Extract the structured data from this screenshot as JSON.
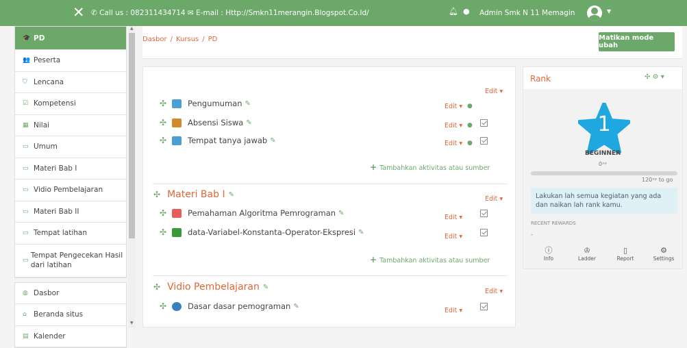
{
  "header": {
    "close_glyph": "✕",
    "contact_text": "Call us : 082311434714 ✉ E-mail : Http://Smkn11merangin.Blogspot.Co.Id/",
    "user_name": "Admin Smk N 11 Memagin",
    "icons": [
      "close-icon",
      "phone-icon",
      "bell-icon",
      "chat-icon",
      "avatar-icon",
      "caret-down-icon"
    ]
  },
  "sidebar": {
    "items": [
      {
        "label": "PD",
        "icon": "graduation-cap-icon",
        "glyph": "🎓",
        "active": true
      },
      {
        "label": "Peserta",
        "icon": "users-icon",
        "glyph": "👥"
      },
      {
        "label": "Lencana",
        "icon": "shield-icon",
        "glyph": "⛉"
      },
      {
        "label": "Kompetensi",
        "icon": "checkbox-icon",
        "glyph": "☑"
      },
      {
        "label": "Nilai",
        "icon": "table-icon",
        "glyph": "▦"
      },
      {
        "label": "Umum",
        "icon": "folder-icon",
        "glyph": "▭"
      },
      {
        "label": "Materi Bab I",
        "icon": "folder-icon",
        "glyph": "▭"
      },
      {
        "label": "Vidio Pembelajaran",
        "icon": "folder-icon",
        "glyph": "▭"
      },
      {
        "label": "Materi Bab II",
        "icon": "folder-icon",
        "glyph": "▭"
      },
      {
        "label": "Tempat latihan",
        "icon": "folder-icon",
        "glyph": "▭"
      },
      {
        "label": "Tempat Pengecekan Hasil dari latihan",
        "icon": "folder-icon",
        "glyph": "▭"
      }
    ],
    "items2": [
      {
        "label": "Dasbor",
        "icon": "dashboard-icon",
        "glyph": "◍"
      },
      {
        "label": "Beranda situs",
        "icon": "home-icon",
        "glyph": "⌂"
      },
      {
        "label": "Kalender",
        "icon": "calendar-icon",
        "glyph": "▤"
      }
    ]
  },
  "breadcrumb": {
    "items": [
      "Dasbor",
      "Kursus",
      "PD"
    ],
    "separator": "/"
  },
  "edit_mode_button": "Matikan mode ubah",
  "course": {
    "top_edit": "Edit ▾",
    "general": [
      {
        "name": "Pengumuman",
        "icon": "forum-icon",
        "color": "#4a9fd5",
        "edit": "Edit ▾",
        "check": false
      },
      {
        "name": "Absensi Siswa",
        "icon": "attendance-icon",
        "color": "#d08a2c",
        "edit": "Edit ▾",
        "check": true
      },
      {
        "name": "Tempat tanya jawab",
        "icon": "forum-icon",
        "color": "#4a9fd5",
        "edit": "Edit ▾",
        "check": true
      }
    ],
    "add_activity": "Tambahkan aktivitas atau sumber",
    "sections": [
      {
        "title": "Materi Bab I",
        "edit": "Edit ▾",
        "activities": [
          {
            "name": "Pemahaman Algoritma Pemrograman",
            "icon": "file-image-icon",
            "color": "#e85c5c",
            "edit": "Edit ▾"
          },
          {
            "name": "data-Variabel-Konstanta-Operator-Ekspresi",
            "icon": "book-icon",
            "color": "#3a9a3a",
            "edit": "Edit ▾"
          }
        ]
      },
      {
        "title": "Vidio Pembelajaran",
        "edit": "Edit ▾",
        "activities": [
          {
            "name": "Dasar dasar pemograman",
            "icon": "video-icon",
            "color": "#3a7fc1",
            "edit": "Edit ▾"
          }
        ]
      }
    ]
  },
  "rank": {
    "title": "Rank",
    "tools": "✣ ⚙ ▾",
    "level": "1",
    "level_name": "BEGINNER",
    "xp": "0ˣᵖ",
    "next_xp": "120ˣᵖ to go",
    "progress": 0,
    "info": "Lakukan lah semua kegiatan yang ada dan naikan lah rank kamu.",
    "recent_rewards": "RECENT REWARDS",
    "dash": "-",
    "tabs": [
      {
        "label": "Info",
        "glyph": "ⓘ",
        "icon": "info-icon"
      },
      {
        "label": "Ladder",
        "glyph": "♔",
        "icon": "trophy-icon"
      },
      {
        "label": "Report",
        "glyph": "▯",
        "icon": "report-icon"
      },
      {
        "label": "Settings",
        "glyph": "⚙",
        "icon": "settings-icon"
      }
    ]
  },
  "colors": {
    "primary": "#6ba86a",
    "accent": "#e0673a",
    "star": "#1fa7e0"
  }
}
